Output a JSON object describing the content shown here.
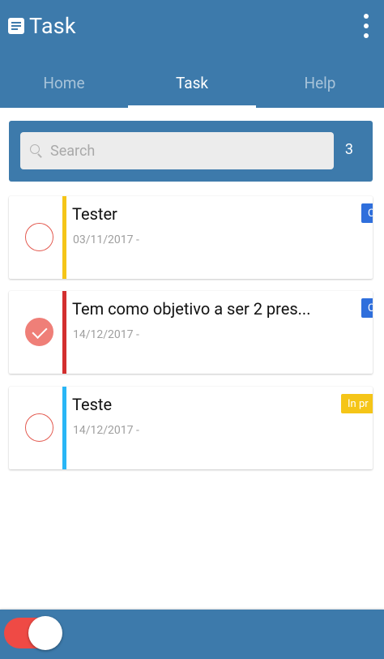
{
  "app": {
    "title": "Task",
    "title_icon": "task-list-icon",
    "menu_icon": "more-vert-icon"
  },
  "tabs": [
    {
      "label": "Home",
      "active": false
    },
    {
      "label": "Task",
      "active": true
    },
    {
      "label": "Help",
      "active": false
    }
  ],
  "search": {
    "placeholder": "Search",
    "value": "",
    "count": "3",
    "icon": "search-icon"
  },
  "tasks": [
    {
      "title": "Tester",
      "date": "03/11/2017 -",
      "checked": false,
      "priority_color": "#f5c518",
      "status": "C",
      "status_color": "#2f6fdc"
    },
    {
      "title": "Tem como objetivo a ser 2 pres...",
      "date": "14/12/2017 -",
      "checked": true,
      "priority_color": "#d32f2f",
      "status": "C",
      "status_color": "#2f6fdc"
    },
    {
      "title": "Teste",
      "date": "14/12/2017 -",
      "checked": false,
      "priority_color": "#29b6f6",
      "status": "In pr",
      "status_color": "#f5c518"
    }
  ],
  "bottom": {
    "toggle_on": true,
    "toggle_color": "#ef4a45"
  },
  "colors": {
    "primary": "#3d7aab",
    "check": "#e35a50"
  }
}
